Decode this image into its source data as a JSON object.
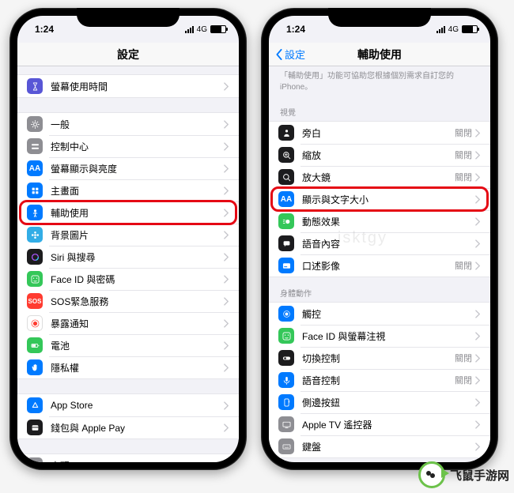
{
  "status": {
    "time": "1:24",
    "carrier": "4G"
  },
  "left": {
    "title": "設定",
    "groups": [
      {
        "items": [
          {
            "icon": "hourglass",
            "cls": "ic-purple",
            "label": "螢幕使用時間"
          }
        ]
      },
      {
        "items": [
          {
            "icon": "gear",
            "cls": "ic-gray",
            "label": "一般"
          },
          {
            "icon": "switches",
            "cls": "ic-gray",
            "label": "控制中心"
          },
          {
            "icon": "aa",
            "cls": "ic-blue",
            "label": "螢幕顯示與亮度"
          },
          {
            "icon": "grid",
            "cls": "ic-blue",
            "label": "主畫面"
          },
          {
            "icon": "person",
            "cls": "ic-blue",
            "label": "輔助使用",
            "highlight": true
          },
          {
            "icon": "flower",
            "cls": "ic-teal",
            "label": "背景圖片"
          },
          {
            "icon": "siri",
            "cls": "ic-black",
            "label": "Siri 與搜尋"
          },
          {
            "icon": "faceid",
            "cls": "ic-green",
            "label": "Face ID 與密碼"
          },
          {
            "icon": "sos",
            "cls": "ic-red",
            "label": "SOS緊急服務"
          },
          {
            "icon": "dot",
            "cls": "ic-white",
            "label": "暴露通知"
          },
          {
            "icon": "battery",
            "cls": "ic-green",
            "label": "電池"
          },
          {
            "icon": "hand",
            "cls": "ic-blue",
            "label": "隱私權"
          }
        ]
      },
      {
        "items": [
          {
            "icon": "appstore",
            "cls": "ic-blue",
            "label": "App Store"
          },
          {
            "icon": "wallet",
            "cls": "ic-black",
            "label": "錢包與 Apple Pay"
          }
        ]
      },
      {
        "items": [
          {
            "icon": "key",
            "cls": "ic-gray",
            "label": "密碼"
          }
        ]
      }
    ]
  },
  "right": {
    "back": "設定",
    "title": "輔助使用",
    "note": "「輔助使用」功能可協助您根據個別需求自訂您的 iPhone。",
    "sections": [
      {
        "label": "視覺",
        "items": [
          {
            "icon": "voiceover",
            "cls": "ic-black",
            "label": "旁白",
            "detail": "關閉"
          },
          {
            "icon": "zoom",
            "cls": "ic-black",
            "label": "縮放",
            "detail": "關閉"
          },
          {
            "icon": "loupe",
            "cls": "ic-black",
            "label": "放大鏡",
            "detail": "關閉"
          },
          {
            "icon": "aa",
            "cls": "ic-blue",
            "label": "顯示與文字大小",
            "highlight": true
          },
          {
            "icon": "motion",
            "cls": "ic-green",
            "label": "動態效果"
          },
          {
            "icon": "speech",
            "cls": "ic-black",
            "label": "語音內容"
          },
          {
            "icon": "caption",
            "cls": "ic-blue",
            "label": "口述影像",
            "detail": "關閉"
          }
        ]
      },
      {
        "label": "身體動作",
        "items": [
          {
            "icon": "touch",
            "cls": "ic-blue",
            "label": "觸控"
          },
          {
            "icon": "faceid",
            "cls": "ic-green",
            "label": "Face ID 與螢幕注視"
          },
          {
            "icon": "switch",
            "cls": "ic-black",
            "label": "切換控制",
            "detail": "關閉"
          },
          {
            "icon": "mic",
            "cls": "ic-blue",
            "label": "語音控制",
            "detail": "關閉"
          },
          {
            "icon": "side",
            "cls": "ic-blue",
            "label": "側邊按鈕"
          },
          {
            "icon": "tv",
            "cls": "ic-gray",
            "label": "Apple TV 遙控器"
          },
          {
            "icon": "keyboard",
            "cls": "ic-gray",
            "label": "鍵盤"
          }
        ]
      }
    ]
  },
  "watermark": "isktgy",
  "brand": "飞鼠手游网"
}
